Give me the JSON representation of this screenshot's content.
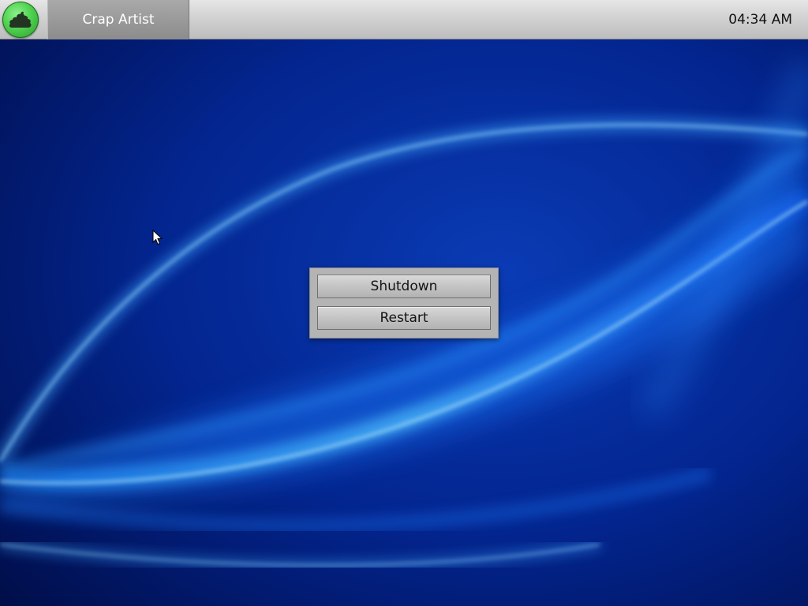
{
  "taskbar": {
    "start_icon": "poop-icon",
    "active_window_title": "Crap Artist",
    "clock_time": "04:34 AM"
  },
  "dialog": {
    "shutdown_label": "Shutdown",
    "restart_label": "Restart"
  },
  "colors": {
    "wallpaper_base": "#00155f",
    "wallpaper_light": "#29a8ff",
    "start_orb": "#4fd14f",
    "taskbar": "#d0d0d0"
  }
}
